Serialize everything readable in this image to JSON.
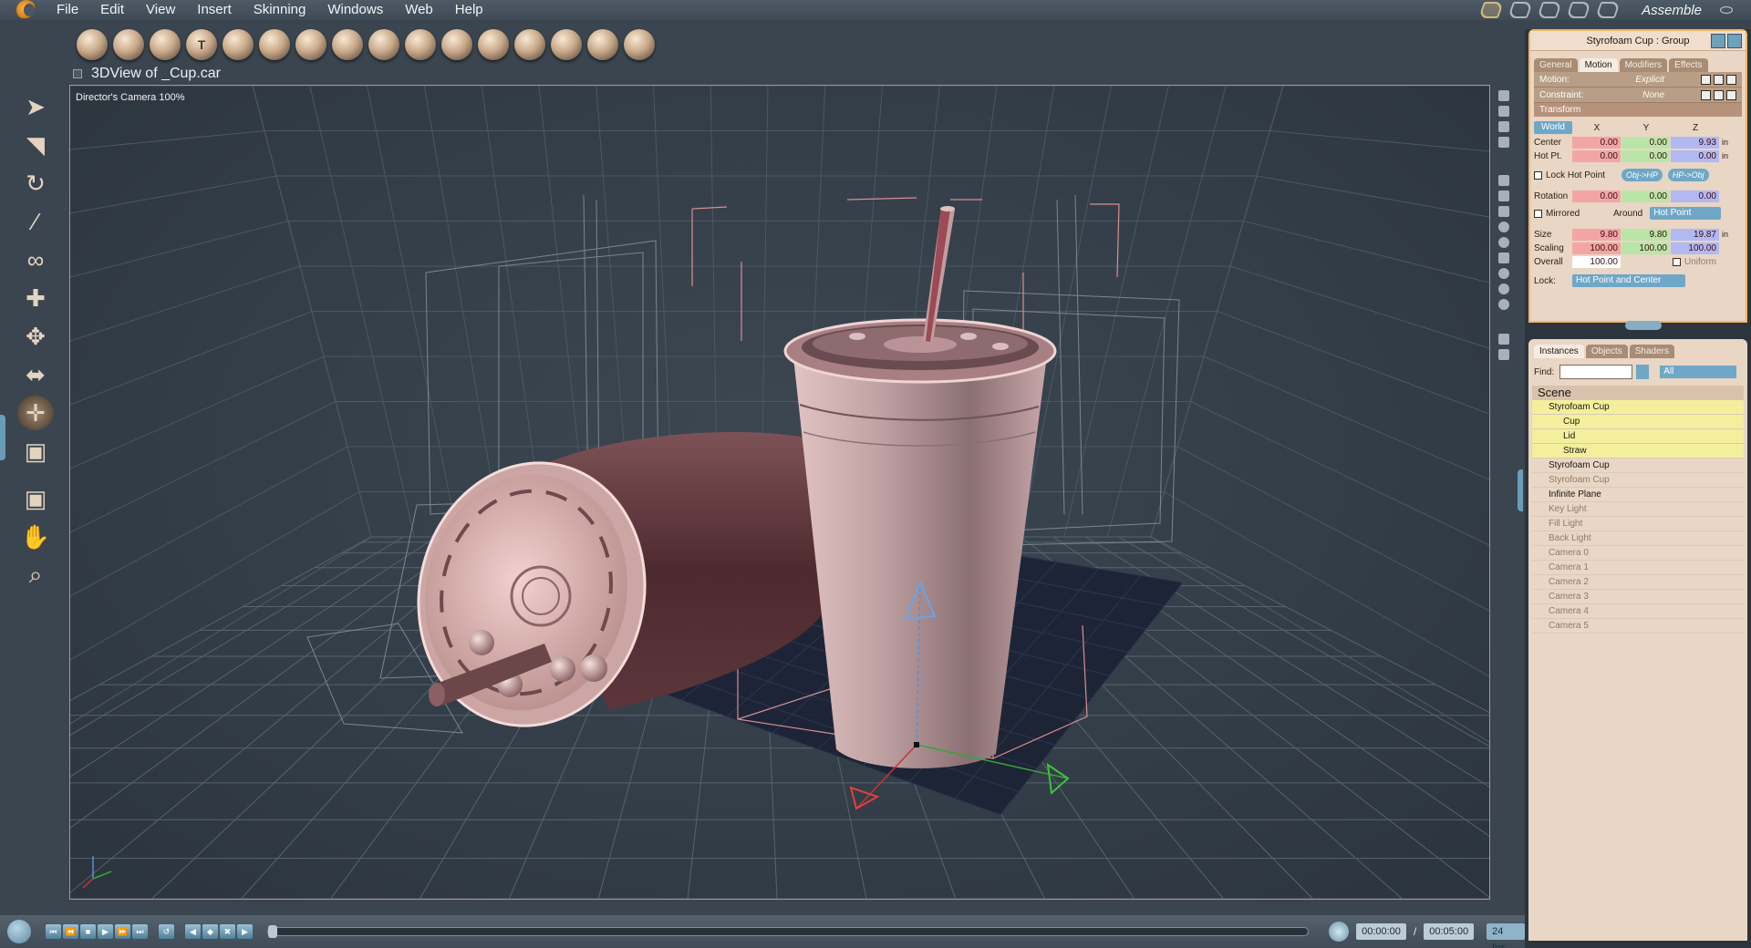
{
  "menu": {
    "items": [
      "File",
      "Edit",
      "View",
      "Insert",
      "Skinning",
      "Windows",
      "Web",
      "Help"
    ],
    "room_label": "Assemble"
  },
  "toolbar": {
    "icons": [
      "sphere-icon",
      "goblet-icon",
      "globe-icon",
      "text-icon",
      "flame-icon",
      "torus-icon",
      "mountain-icon",
      "gear-icon",
      "tree-icon",
      "terrain-icon",
      "sculpt-icon",
      "arch-icon",
      "cloud-icon",
      "swirl-icon",
      "disc-icon",
      "scissors-icon"
    ]
  },
  "viewport": {
    "title": "3DView of _Cup.car",
    "camera_label": "Director's Camera 100%"
  },
  "properties": {
    "title": "Styrofoam Cup : Group",
    "tabs": [
      "General",
      "Motion",
      "Modifiers",
      "Effects"
    ],
    "active_tab": "Motion",
    "motion_label": "Motion:",
    "motion_value": "Explicit",
    "constraint_label": "Constraint:",
    "constraint_value": "None",
    "transform_label": "Transform",
    "space": "World",
    "axes": [
      "X",
      "Y",
      "Z"
    ],
    "center": {
      "label": "Center",
      "x": "0.00",
      "y": "0.00",
      "z": "9.93",
      "unit": "in"
    },
    "hotpoint": {
      "label": "Hot Pt.",
      "x": "0.00",
      "y": "0.00",
      "z": "0.00",
      "unit": "in"
    },
    "lock_hot_point": "Lock Hot Point",
    "obj_hp": "Obj->HP",
    "hp_obj": "HP->Obj",
    "rotation": {
      "label": "Rotation",
      "x": "0.00",
      "y": "0.00",
      "z": "0.00"
    },
    "mirrored": "Mirrored",
    "around_label": "Around",
    "around_value": "Hot Point",
    "size": {
      "label": "Size",
      "x": "9.80",
      "y": "9.80",
      "z": "19.87",
      "unit": "in"
    },
    "scaling": {
      "label": "Scaling",
      "x": "100.00",
      "y": "100.00",
      "z": "100.00"
    },
    "overall": {
      "label": "Overall",
      "value": "100.00"
    },
    "uniform": "Uniform",
    "lock_label": "Lock:",
    "lock_value": "Hot Point and Center"
  },
  "browser": {
    "tabs": [
      "Instances",
      "Objects",
      "Shaders"
    ],
    "active_tab": "Instances",
    "find_label": "Find:",
    "filter_value": "All",
    "scene_label": "Scene",
    "tree": [
      {
        "label": "Styrofoam Cup",
        "level": 0,
        "selected": true
      },
      {
        "label": "Cup",
        "level": 1,
        "selected": true
      },
      {
        "label": "Lid",
        "level": 1,
        "selected": true
      },
      {
        "label": "Straw",
        "level": 1,
        "selected": true
      },
      {
        "label": "Styrofoam Cup",
        "level": 0,
        "selected": false
      },
      {
        "label": "Styrofoam Cup",
        "level": 0,
        "selected": false,
        "dim": true
      },
      {
        "label": "Infinite Plane",
        "level": 0,
        "selected": false
      },
      {
        "label": "Key Light",
        "level": 0,
        "selected": false,
        "dim": true
      },
      {
        "label": "Fill Light",
        "level": 0,
        "selected": false,
        "dim": true
      },
      {
        "label": "Back Light",
        "level": 0,
        "selected": false,
        "dim": true
      },
      {
        "label": "Camera 0",
        "level": 0,
        "selected": false,
        "dim": true
      },
      {
        "label": "Camera 1",
        "level": 0,
        "selected": false,
        "dim": true
      },
      {
        "label": "Camera 2",
        "level": 0,
        "selected": false,
        "dim": true
      },
      {
        "label": "Camera 3",
        "level": 0,
        "selected": false,
        "dim": true
      },
      {
        "label": "Camera 4",
        "level": 0,
        "selected": false,
        "dim": true
      },
      {
        "label": "Camera 5",
        "level": 0,
        "selected": false,
        "dim": true
      }
    ]
  },
  "timeline": {
    "current_time": "00:00:00",
    "separator": "/",
    "end_time": "00:05:00",
    "fps": "24 fps"
  },
  "colors": {
    "cup": "#c9a3a3",
    "accent_blue": "#6fa7c7",
    "panel_bg": "#e9d6c4",
    "selection": "#f4ef9c"
  }
}
